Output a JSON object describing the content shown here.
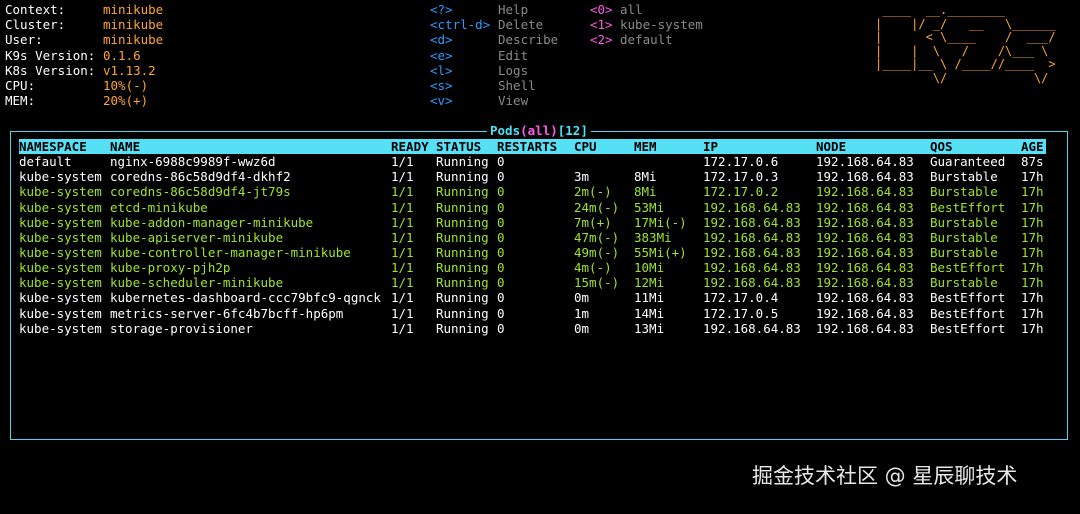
{
  "info": [
    {
      "key": "Context:",
      "value": "minikube"
    },
    {
      "key": "Cluster:",
      "value": "minikube"
    },
    {
      "key": "User:",
      "value": "minikube"
    },
    {
      "key": "K9s Version:",
      "value": "0.1.6"
    },
    {
      "key": "K8s Version:",
      "value": "v1.13.2"
    },
    {
      "key": "CPU:",
      "value": "10%(-)"
    },
    {
      "key": "MEM:",
      "value": "20%(+)"
    }
  ],
  "shortcuts": [
    {
      "key": "<?>",
      "desc": "Help"
    },
    {
      "key": "<ctrl-d>",
      "desc": "Delete"
    },
    {
      "key": "<d>",
      "desc": "Describe"
    },
    {
      "key": "<e>",
      "desc": "Edit"
    },
    {
      "key": "<l>",
      "desc": "Logs"
    },
    {
      "key": "<s>",
      "desc": "Shell"
    },
    {
      "key": "<v>",
      "desc": "View"
    }
  ],
  "namespaces": [
    {
      "key": "<0>",
      "desc": "all"
    },
    {
      "key": "<1>",
      "desc": "kube-system"
    },
    {
      "key": "<2>",
      "desc": "default"
    }
  ],
  "logo": " ____  __.________       \n|    |/ _/   __   \\______\n|      < \\____    /  ___/\n|    |  \\   /    /\\___ \\ \n|____|__ \\ /____//____  >\n        \\/            \\/ ",
  "table": {
    "title": "Pods",
    "filter": "all",
    "count": "12",
    "columns": [
      "NAMESPACE",
      "NAME",
      "READY",
      "STATUS",
      "RESTARTS",
      "CPU",
      "MEM",
      "IP",
      "NODE",
      "QOS",
      "AGE"
    ],
    "rows": [
      {
        "color": "white",
        "cells": [
          "default",
          "nginx-6988c9989f-wwz6d",
          "1/1",
          "Running",
          "0",
          "",
          "",
          "172.17.0.6",
          "192.168.64.83",
          "Guaranteed",
          "87s"
        ]
      },
      {
        "color": "white",
        "cells": [
          "kube-system",
          "coredns-86c58d9df4-dkhf2",
          "1/1",
          "Running",
          "0",
          "3m",
          "8Mi",
          "172.17.0.3",
          "192.168.64.83",
          "Burstable",
          "17h"
        ]
      },
      {
        "color": "green",
        "cells": [
          "kube-system",
          "coredns-86c58d9df4-jt79s",
          "1/1",
          "Running",
          "0",
          "2m(-)",
          "8Mi",
          "172.17.0.2",
          "192.168.64.83",
          "Burstable",
          "17h"
        ]
      },
      {
        "color": "green",
        "cells": [
          "kube-system",
          "etcd-minikube",
          "1/1",
          "Running",
          "0",
          "24m(-)",
          "53Mi",
          "192.168.64.83",
          "192.168.64.83",
          "BestEffort",
          "17h"
        ]
      },
      {
        "color": "green",
        "cells": [
          "kube-system",
          "kube-addon-manager-minikube",
          "1/1",
          "Running",
          "0",
          "7m(+)",
          "17Mi(-)",
          "192.168.64.83",
          "192.168.64.83",
          "Burstable",
          "17h"
        ]
      },
      {
        "color": "green",
        "cells": [
          "kube-system",
          "kube-apiserver-minikube",
          "1/1",
          "Running",
          "0",
          "47m(-)",
          "383Mi",
          "192.168.64.83",
          "192.168.64.83",
          "Burstable",
          "17h"
        ]
      },
      {
        "color": "green",
        "cells": [
          "kube-system",
          "kube-controller-manager-minikube",
          "1/1",
          "Running",
          "0",
          "49m(-)",
          "55Mi(+)",
          "192.168.64.83",
          "192.168.64.83",
          "Burstable",
          "17h"
        ]
      },
      {
        "color": "green",
        "cells": [
          "kube-system",
          "kube-proxy-pjh2p",
          "1/1",
          "Running",
          "0",
          "4m(-)",
          "10Mi",
          "192.168.64.83",
          "192.168.64.83",
          "BestEffort",
          "17h"
        ]
      },
      {
        "color": "green",
        "cells": [
          "kube-system",
          "kube-scheduler-minikube",
          "1/1",
          "Running",
          "0",
          "15m(-)",
          "12Mi",
          "192.168.64.83",
          "192.168.64.83",
          "Burstable",
          "17h"
        ]
      },
      {
        "color": "white",
        "cells": [
          "kube-system",
          "kubernetes-dashboard-ccc79bfc9-qgnck",
          "1/1",
          "Running",
          "0",
          "0m",
          "11Mi",
          "172.17.0.4",
          "192.168.64.83",
          "BestEffort",
          "17h"
        ]
      },
      {
        "color": "white",
        "cells": [
          "kube-system",
          "metrics-server-6fc4b7bcff-hp6pm",
          "1/1",
          "Running",
          "0",
          "1m",
          "14Mi",
          "172.17.0.5",
          "192.168.64.83",
          "BestEffort",
          "17h"
        ]
      },
      {
        "color": "white",
        "cells": [
          "kube-system",
          "storage-provisioner",
          "1/1",
          "Running",
          "0",
          "0m",
          "13Mi",
          "192.168.64.83",
          "192.168.64.83",
          "BestEffort",
          "17h"
        ]
      }
    ]
  },
  "colors": {
    "info_value": "#ffa52e",
    "shortcut_key": "#2f9bff",
    "namespace_key": "#ff5ce6",
    "header_bg": "#56e0f6",
    "row_green": "#9fe42c",
    "frame": "#58d0f0"
  },
  "watermark": "掘金技术社区 @ 星辰聊技术"
}
